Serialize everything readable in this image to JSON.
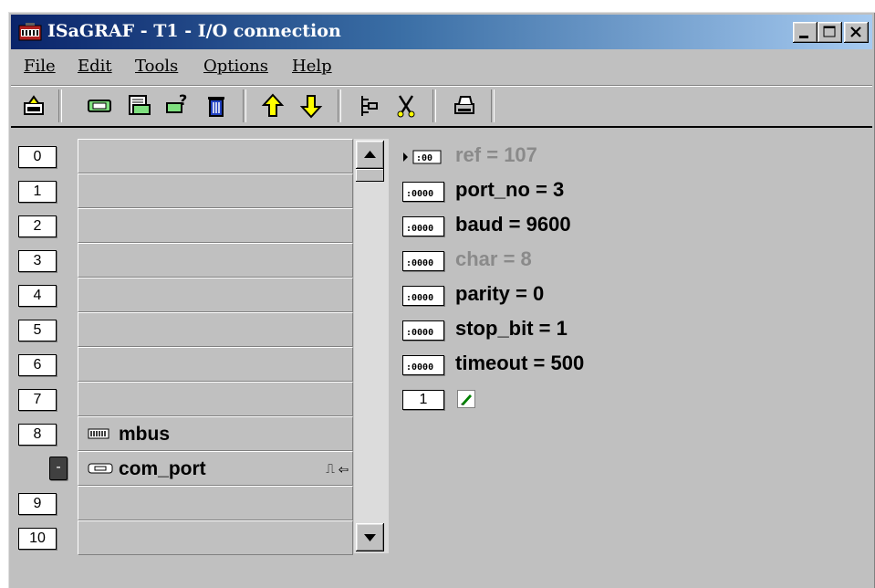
{
  "window": {
    "title": "ISaGRAF - T1 - I/O connection"
  },
  "menu": {
    "items": [
      {
        "label": "File",
        "accel_index": 0
      },
      {
        "label": "Edit",
        "accel_index": 0
      },
      {
        "label": "Tools",
        "accel_index": 0
      },
      {
        "label": "Options",
        "accel_index": 0
      },
      {
        "label": "Help",
        "accel_index": 0
      }
    ]
  },
  "toolbar": {
    "icons": [
      "open-board-icon",
      "set-board-icon",
      "board-params-icon",
      "help-board-icon",
      "delete-icon",
      "move-up-icon",
      "move-down-icon",
      "connect-icon",
      "disconnect-icon",
      "print-icon"
    ]
  },
  "slots": [
    {
      "num": "0",
      "label": ""
    },
    {
      "num": "1",
      "label": ""
    },
    {
      "num": "2",
      "label": ""
    },
    {
      "num": "3",
      "label": ""
    },
    {
      "num": "4",
      "label": ""
    },
    {
      "num": "5",
      "label": ""
    },
    {
      "num": "6",
      "label": ""
    },
    {
      "num": "7",
      "label": ""
    },
    {
      "num": "8",
      "label": "mbus"
    },
    {
      "num": "-",
      "label": "com_port"
    },
    {
      "num": "9",
      "label": ""
    },
    {
      "num": "10",
      "label": ""
    }
  ],
  "params": [
    {
      "text": "ref = 107",
      "disabled": true
    },
    {
      "text": "port_no = 3",
      "disabled": false
    },
    {
      "text": "baud = 9600",
      "disabled": false
    },
    {
      "text": "char = 8",
      "disabled": true
    },
    {
      "text": "parity = 0",
      "disabled": false
    },
    {
      "text": "stop_bit = 1",
      "disabled": false
    },
    {
      "text": "timeout = 500",
      "disabled": false
    }
  ],
  "bottom": {
    "index": "1"
  },
  "colors": {
    "title_start": "#0a246a",
    "title_end": "#a6caf0",
    "face": "#c0c0c0"
  }
}
